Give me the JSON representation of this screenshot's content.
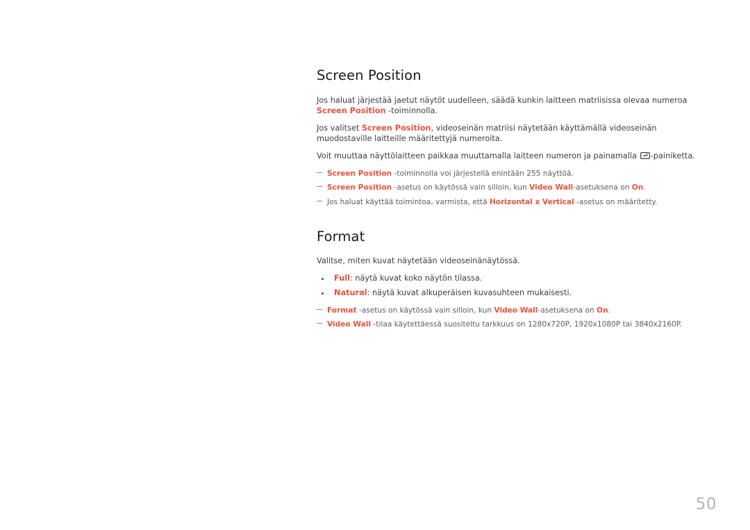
{
  "page": {
    "number": "50",
    "accent_color": "#e8523b",
    "body_color": "#3d3d3d",
    "note_color": "#5d5d5d",
    "heading_color": "#1a1a1a",
    "page_number_color": "#b4b4b4",
    "background": "#ffffff"
  },
  "sections": [
    {
      "title": "Screen Position",
      "paragraphs": [
        {
          "runs": [
            {
              "text": "Jos haluat järjestää jaetut näytöt uudelleen, säädä kunkin laitteen matriisissa olevaa numeroa ",
              "style": "normal"
            },
            {
              "text": "Screen Position",
              "style": "accent"
            },
            {
              "text": " -toiminnolla.",
              "style": "normal"
            }
          ]
        },
        {
          "runs": [
            {
              "text": "Jos valitset ",
              "style": "normal"
            },
            {
              "text": "Screen Position",
              "style": "accent"
            },
            {
              "text": ", videoseinän matriisi näytetään käyttämällä videoseinän muodostaville laitteille määritettyjä numeroita.",
              "style": "normal"
            }
          ]
        },
        {
          "runs": [
            {
              "text": "Voit muuttaa näyttölaitteen paikkaa muuttamalla laitteen numeron ja painamalla ",
              "style": "normal"
            },
            {
              "text": "",
              "style": "enter-key-icon"
            },
            {
              "text": "-painiketta.",
              "style": "normal"
            }
          ]
        }
      ],
      "notes": [
        {
          "runs": [
            {
              "text": "Screen Position",
              "style": "accent"
            },
            {
              "text": " -toiminnolla voi järjestellä enintään 255 näyttöä.",
              "style": "normal"
            }
          ]
        },
        {
          "runs": [
            {
              "text": "Screen Position",
              "style": "accent"
            },
            {
              "text": " -asetus on käytössä vain silloin, kun ",
              "style": "normal"
            },
            {
              "text": "Video Wall",
              "style": "accent"
            },
            {
              "text": "-asetuksena on ",
              "style": "normal"
            },
            {
              "text": "On",
              "style": "accent"
            },
            {
              "text": ".",
              "style": "normal"
            }
          ]
        },
        {
          "runs": [
            {
              "text": "Jos haluat käyttää toimintoa, varmista, että ",
              "style": "normal"
            },
            {
              "text": "Horizontal x Vertical",
              "style": "accent"
            },
            {
              "text": " -asetus on määritetty.",
              "style": "normal"
            }
          ]
        }
      ]
    },
    {
      "title": "Format",
      "paragraphs": [
        {
          "runs": [
            {
              "text": "Valitse, miten kuvat näytetään videoseinänäytössä.",
              "style": "normal"
            }
          ]
        }
      ],
      "bullets": [
        {
          "runs": [
            {
              "text": "Full",
              "style": "accent"
            },
            {
              "text": ": näytä kuvat koko näytön tilassa.",
              "style": "normal"
            }
          ]
        },
        {
          "runs": [
            {
              "text": "Natural",
              "style": "accent"
            },
            {
              "text": ": näytä kuvat alkuperäisen kuvasuhteen mukaisesti.",
              "style": "normal"
            }
          ]
        }
      ],
      "notes": [
        {
          "runs": [
            {
              "text": "Format",
              "style": "accent"
            },
            {
              "text": " -asetus on käytössä vain silloin, kun ",
              "style": "normal"
            },
            {
              "text": "Video Wall",
              "style": "accent"
            },
            {
              "text": "-asetuksena on ",
              "style": "normal"
            },
            {
              "text": "On",
              "style": "accent"
            },
            {
              "text": ".",
              "style": "normal"
            }
          ]
        },
        {
          "runs": [
            {
              "text": "Video Wall",
              "style": "accent"
            },
            {
              "text": " -tilaa käytettäessä suositeltu tarkkuus on 1280x720P, 1920x1080P tai 3840x2160P.",
              "style": "normal"
            }
          ]
        }
      ]
    }
  ],
  "icons": {
    "enter_key": "enter-key-icon"
  }
}
